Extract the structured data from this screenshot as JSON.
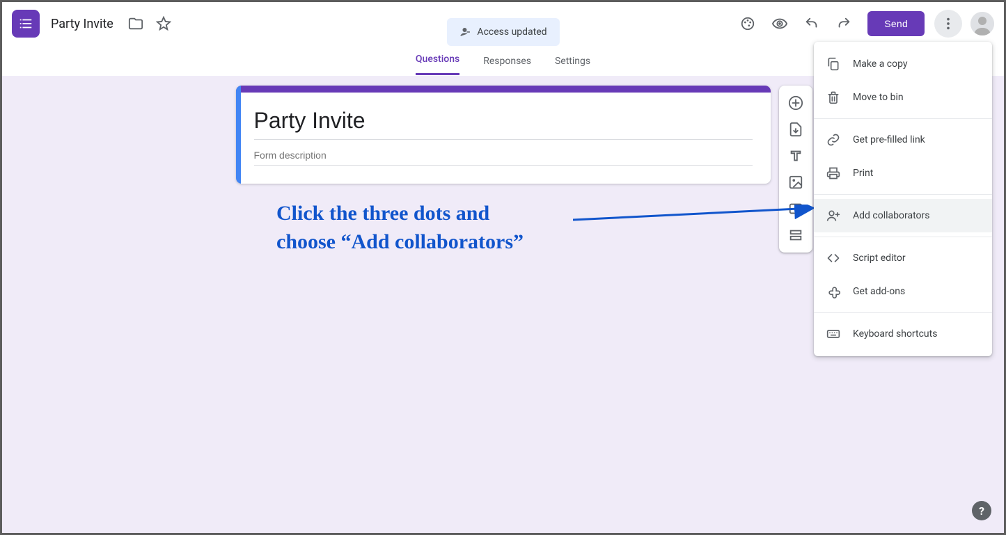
{
  "doc": {
    "title": "Party Invite"
  },
  "chip": {
    "label": "Access updated"
  },
  "actions": {
    "send": "Send"
  },
  "tabs": {
    "questions": "Questions",
    "responses": "Responses",
    "settings": "Settings"
  },
  "form": {
    "title_value": "Party Invite",
    "description_placeholder": "Form description"
  },
  "menu": {
    "make_copy": "Make a copy",
    "move_to_bin": "Move to bin",
    "prefilled": "Get pre-filled link",
    "print": "Print",
    "add_collaborators": "Add collaborators",
    "script_editor": "Script editor",
    "get_addons": "Get add-ons",
    "shortcuts": "Keyboard shortcuts"
  },
  "annotation": {
    "line1": "Click the three dots and",
    "line2": "choose “Add collaborators”"
  }
}
